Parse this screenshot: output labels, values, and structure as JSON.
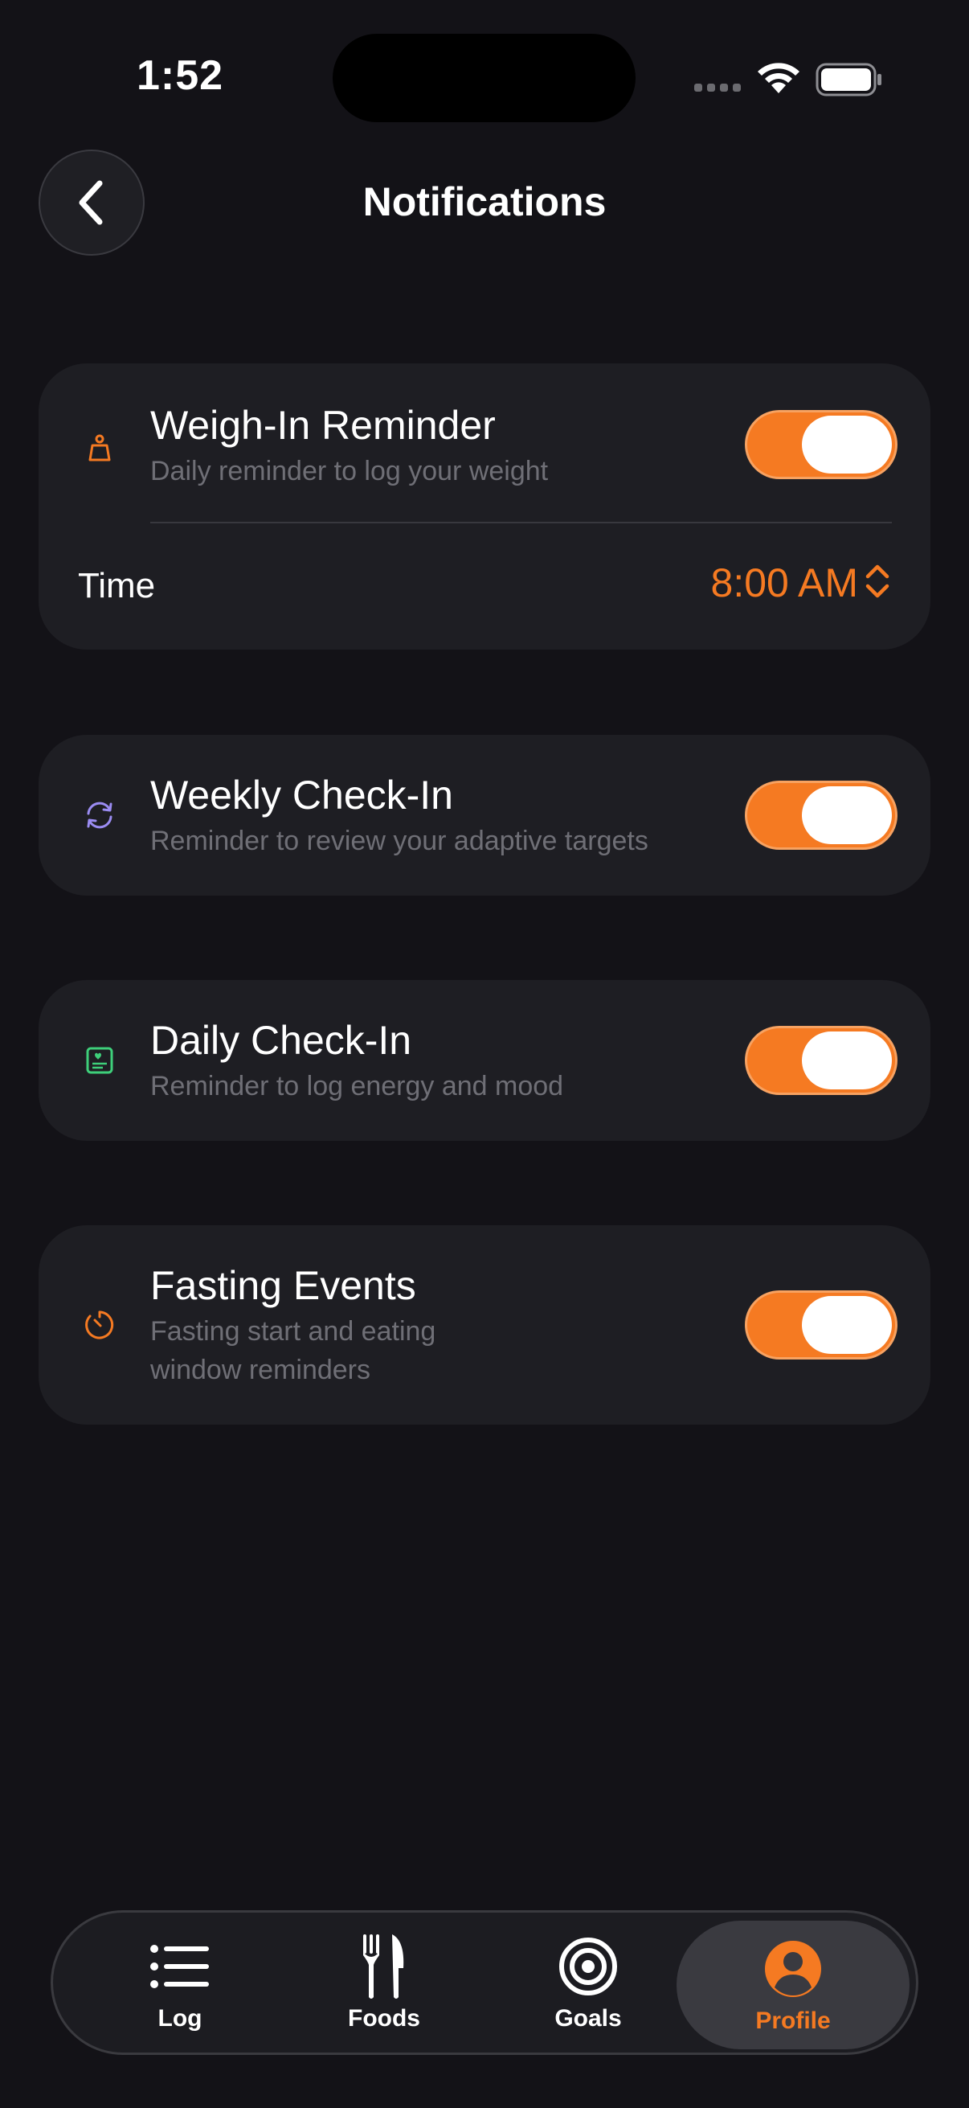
{
  "status_bar": {
    "time": "1:52"
  },
  "header": {
    "title": "Notifications",
    "back_icon": "chevron-left-icon"
  },
  "colors": {
    "accent": "#f57a22",
    "background": "#131217",
    "card": "#1e1e23",
    "weekly_icon": "#9b8cf2",
    "daily_icon": "#3ecf7a"
  },
  "cards": {
    "weigh_in": {
      "icon": "scale-icon",
      "title": "Weigh-In Reminder",
      "subtitle": "Daily reminder to log your weight",
      "enabled": true,
      "time_label": "Time",
      "time_value": "8:00 AM"
    },
    "weekly": {
      "icon": "refresh-icon",
      "title": "Weekly Check-In",
      "subtitle": "Reminder to review your adaptive targets",
      "enabled": true
    },
    "daily": {
      "icon": "heart-card-icon",
      "title": "Daily Check-In",
      "subtitle": "Reminder to log energy and mood",
      "enabled": true
    },
    "fasting": {
      "icon": "timer-icon",
      "title": "Fasting Events",
      "subtitle_line1": "Fasting start and eating",
      "subtitle_line2": "window reminders",
      "enabled": true
    }
  },
  "tabbar": {
    "tabs": [
      {
        "label": "Log",
        "icon": "list-icon",
        "active": false
      },
      {
        "label": "Foods",
        "icon": "fork-knife-icon",
        "active": false
      },
      {
        "label": "Goals",
        "icon": "target-icon",
        "active": false
      },
      {
        "label": "Profile",
        "icon": "person-circle-icon",
        "active": true
      }
    ]
  }
}
